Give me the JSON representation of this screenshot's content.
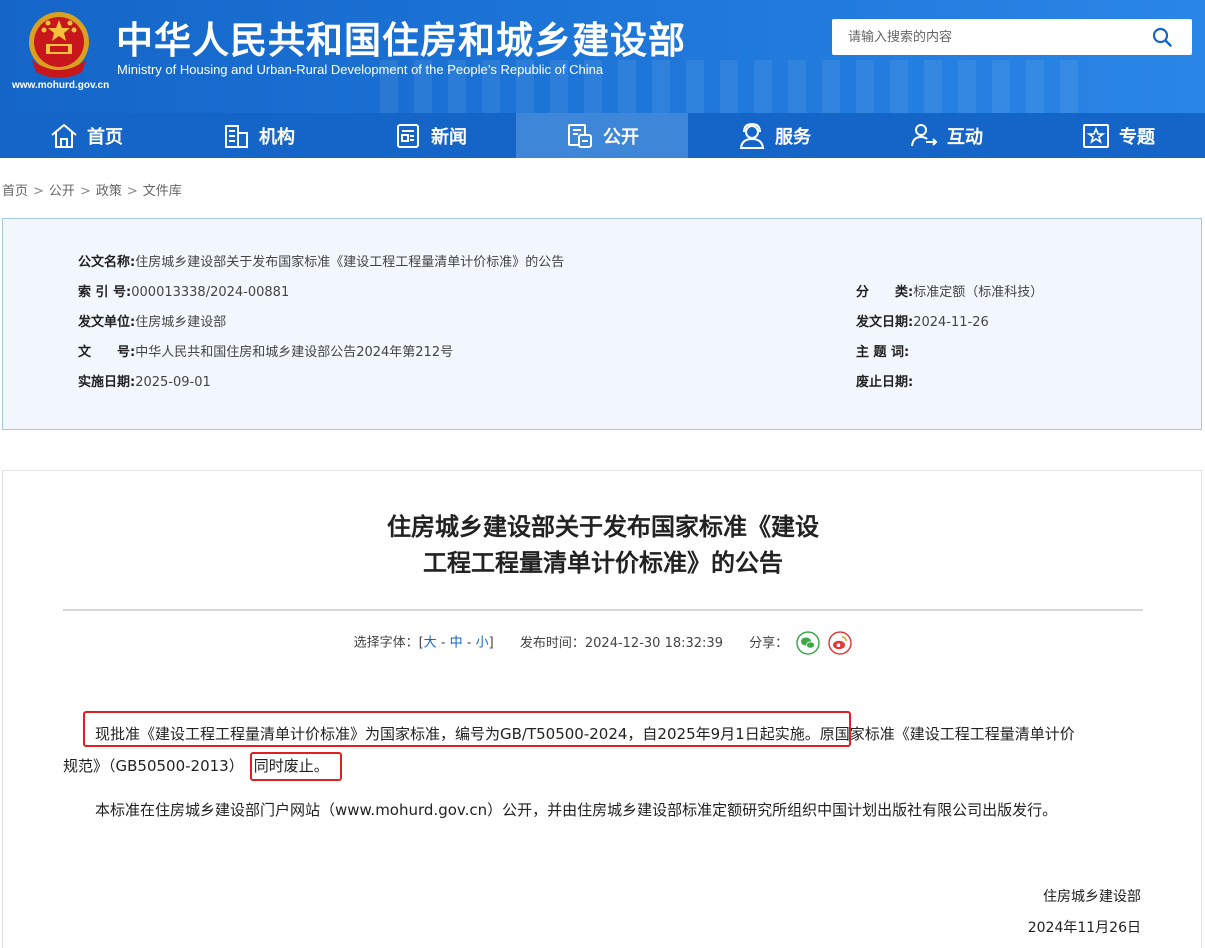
{
  "header": {
    "cn_title": "中华人民共和国住房和城乡建设部",
    "en_title": "Ministry of Housing and Urban-Rural Development of the People’s Republic of China",
    "site_url": "www.mohurd.gov.cn",
    "search_placeholder": "请输入搜索的内容",
    "colors": {
      "brand_blue": "#1565c8",
      "nav_active": "#3d86d8"
    }
  },
  "nav": {
    "items": [
      {
        "label": "首页",
        "icon": "home-icon"
      },
      {
        "label": "机构",
        "icon": "building-icon"
      },
      {
        "label": "新闻",
        "icon": "news-icon"
      },
      {
        "label": "公开",
        "icon": "open-doc-icon",
        "active": true
      },
      {
        "label": "服务",
        "icon": "service-icon"
      },
      {
        "label": "互动",
        "icon": "interact-icon"
      },
      {
        "label": "专题",
        "icon": "topic-star-icon"
      }
    ]
  },
  "breadcrumb": [
    "首页",
    "公开",
    "政策",
    "文件库"
  ],
  "info": {
    "doc_name_label": "公文名称:",
    "doc_name": "住房城乡建设部关于发布国家标准《建设工程工程量清单计价标准》的公告",
    "index_label": "索 引 号:",
    "index": "000013338/2024-00881",
    "category_label": "分　　类:",
    "category": "标准定额（标准科技）",
    "issuer_label": "发文单位:",
    "issuer": "住房城乡建设部",
    "issue_date_label": "发文日期:",
    "issue_date": "2024-11-26",
    "doc_no_label": "文　　号:",
    "doc_no": "中华人民共和国住房和城乡建设部公告2024年第212号",
    "subject_label": "主 题 词:",
    "subject": "",
    "effective_label": "实施日期:",
    "effective": "2025-09-01",
    "abolish_label": "废止日期:",
    "abolish": ""
  },
  "article": {
    "title_line1": "住房城乡建设部关于发布国家标准《建设",
    "title_line2": "工程工程量清单计价标准》的公告",
    "font_label": "选择字体：[",
    "font_large": "大",
    "font_mid": "中",
    "font_small": "小",
    "font_end": "]",
    "publish_label": "发布时间：",
    "publish_time": "2024-12-30 18:32:39",
    "share_label": "分享：",
    "p1_part1": "现批准《建设工程工程量清单计价标准》为国家标准，编号为GB/T50500-2024，自2025年9月1日起实施。",
    "p1_part2": "原国家标准《建设工程工程量清单计价",
    "p1_line2a": "规范》（GB50500-2013）",
    "p1_line2b": "同时废止。",
    "p2": "本标准在住房城乡建设部门户网站（www.mohurd.gov.cn）公开，并由住房城乡建设部标准定额研究所组织中国计划出版社有限公司出版发行。",
    "sign_org": "住房城乡建设部",
    "sign_date": "2024年11月26日",
    "highlight_color": "#e02020"
  }
}
